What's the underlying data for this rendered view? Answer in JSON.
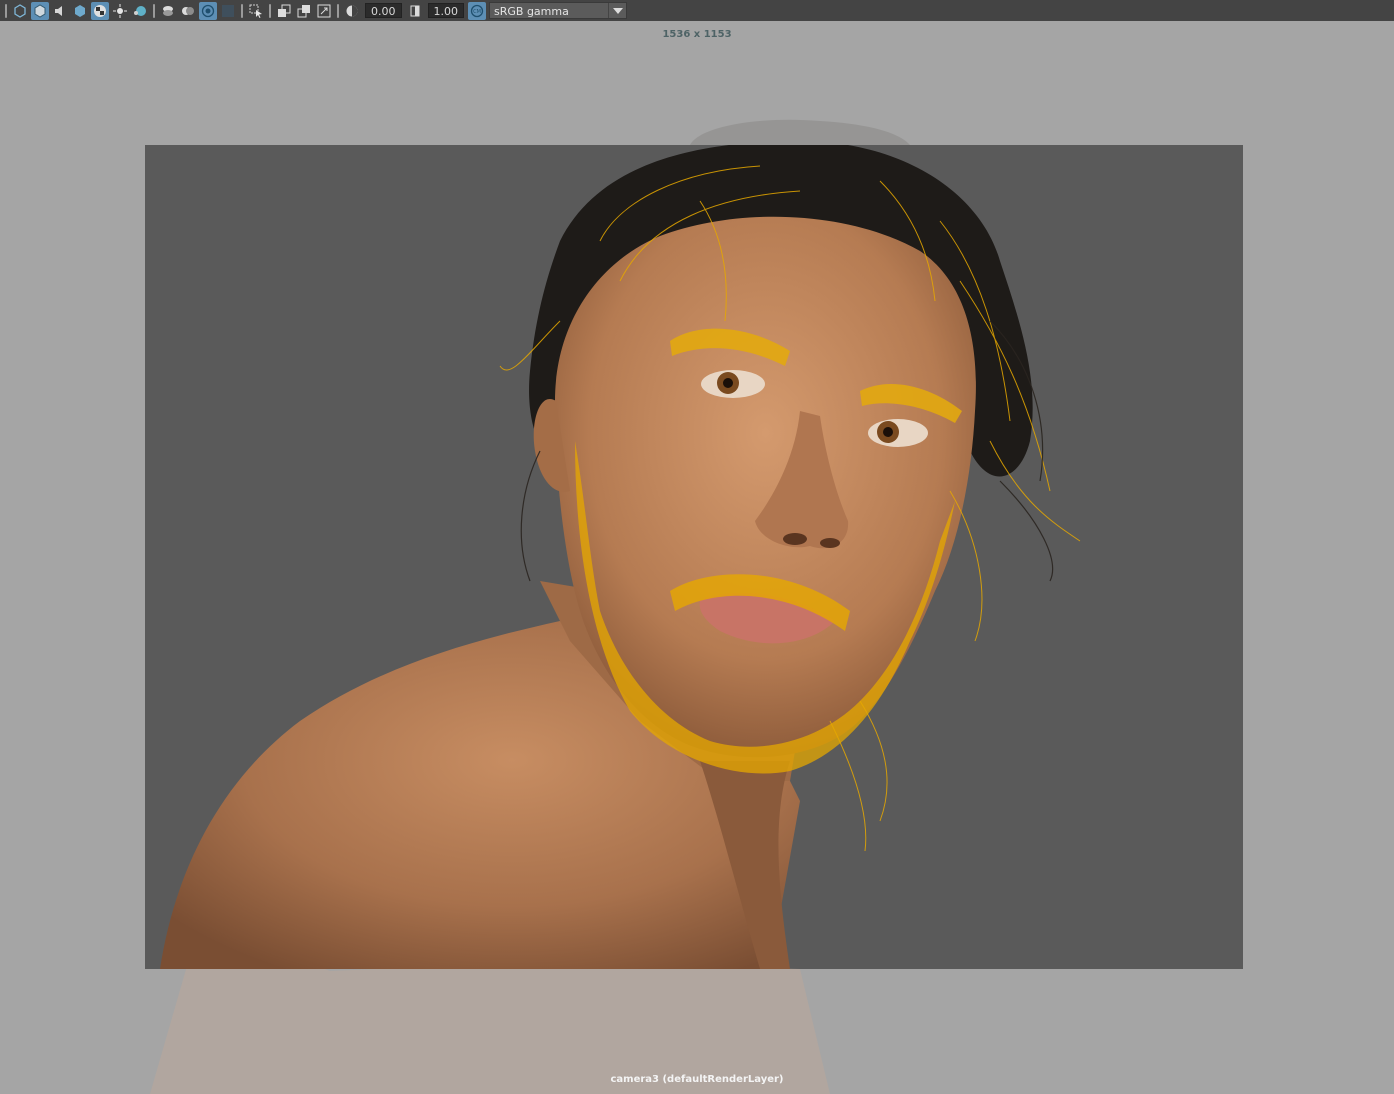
{
  "toolbar": {
    "icons": [
      "camera-icon",
      "cube-icon",
      "speaker-icon",
      "shaded-cube-icon",
      "checker-icon",
      "light-icon",
      "sphere-icon",
      "layers-icon",
      "toggle-icon",
      "target-icon",
      "display-icon",
      "select-icon",
      "copy-icon",
      "paste-icon",
      "resize-icon",
      "exposure-icon",
      "gamma-icon",
      "color-management-icon"
    ],
    "exposure_value": "0.00",
    "gamma_value": "1.00",
    "color_space": "sRGB gamma"
  },
  "viewport": {
    "resolution": "1536 x 1153",
    "camera_label": "camera3 (defaultRenderLayer)"
  },
  "colors": {
    "toolbar_bg": "#444444",
    "viewport_bg": "#a5a5a5",
    "render_gate_bg": "#5a5a5a",
    "active_button": "#5d8fb5",
    "hair_guides": "#e6a800"
  }
}
